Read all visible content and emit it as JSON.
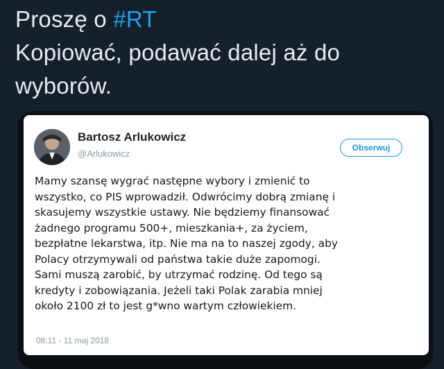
{
  "outer_tweet": {
    "lines": [
      "Kopiować, podawać dalej aż do",
      "wyborów."
    ],
    "first_line_prefix": "Proszę o ",
    "hashtag": "#RT"
  },
  "embedded_tweet": {
    "author_name": "Bartosz Arlukowicz",
    "author_handle": "@Arlukowicz",
    "follow_label": "Obserwuj",
    "body_lines": [
      "Mamy szansę wygrać następne wybory i zmienić to",
      "wszystko, co PIS wprowadził. Odwrócimy dobrą zmianę i",
      "skasujemy wszystkie ustawy. Nie będziemy finansować",
      "żadnego programu 500+, mieszkania+, za życiem,",
      "bezpłatne lekarstwa, itp. Nie ma na to naszej zgody, aby",
      "Polacy otrzymywali od państwa takie duże zapomogi.",
      "Sami muszą zarobić, by utrzymać rodzinę. Od tego są",
      "kredyty i zobowiązania. Jeżeli taki Polak zarabia mniej",
      "około 2100 zł to jest g*wno wartym człowiekiem."
    ],
    "timestamp": "08:11 - 11 maj 2018"
  },
  "colors": {
    "background": "#15202b",
    "text": "#e6ecf0",
    "hashtag": "#1da1f2",
    "card": "#ffffff",
    "follow": "#1b95e0"
  }
}
